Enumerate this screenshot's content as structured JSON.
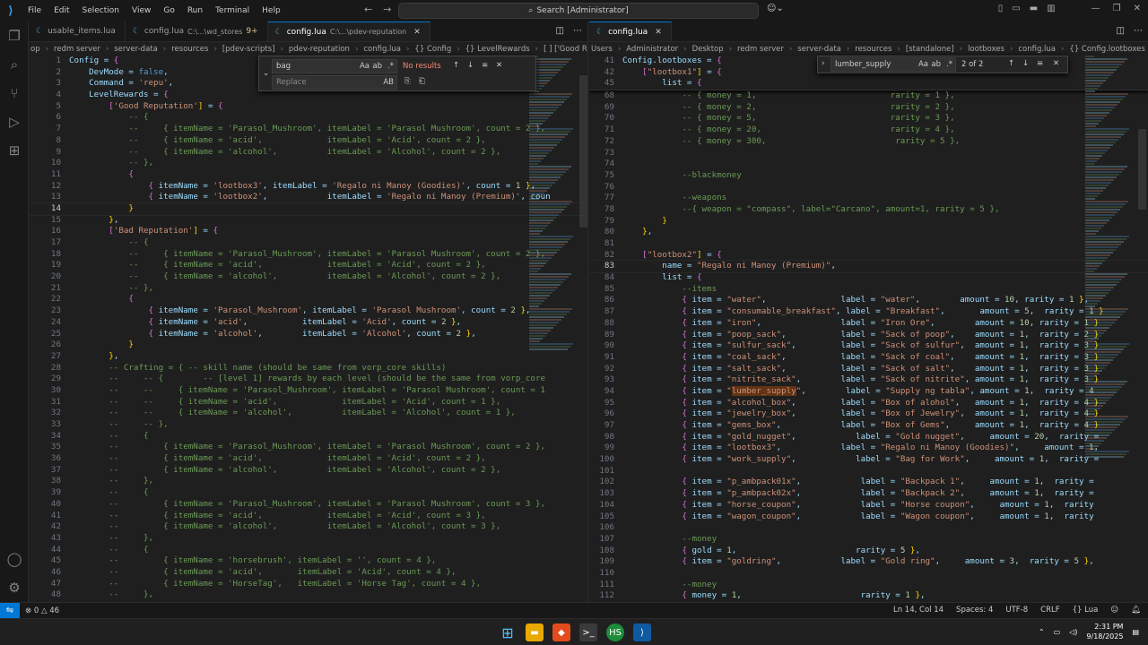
{
  "menu": [
    "File",
    "Edit",
    "Selection",
    "View",
    "Go",
    "Run",
    "Terminal",
    "Help"
  ],
  "command_center": "Search [Administrator]",
  "left": {
    "tabs": [
      {
        "label": "usable_items.lua",
        "desc": "",
        "mod": "",
        "active": false
      },
      {
        "label": "config.lua",
        "desc": "C:\\...\\wd_stores",
        "mod": "9+",
        "active": false
      },
      {
        "label": "config.lua",
        "desc": "C:\\...\\pdev-reputation",
        "mod": "",
        "active": true
      }
    ],
    "breadcrumb": [
      "op",
      "redm server",
      "server-data",
      "resources",
      "[pdev-scripts]",
      "pdev-reputation",
      "config.lua",
      "{} Config",
      "{} LevelRewards",
      "[ ] ['Good Reputation']",
      "[1]"
    ],
    "find": {
      "value": "bag",
      "result": "No results",
      "replace_placeholder": "Replace"
    },
    "cursor_line": 14,
    "lines": [
      {
        "n": 1,
        "t": "Config = {"
      },
      {
        "n": 2,
        "t": "    DevMode = false,"
      },
      {
        "n": 3,
        "t": "    Command = 'repu',"
      },
      {
        "n": 4,
        "t": "    LevelRewards = {"
      },
      {
        "n": 5,
        "t": "        ['Good Reputation'] = {"
      },
      {
        "n": 6,
        "t": "            -- {"
      },
      {
        "n": 7,
        "t": "            --     { itemName = 'Parasol_Mushroom', itemLabel = 'Parasol Mushroom', count = 2 },"
      },
      {
        "n": 8,
        "t": "            --     { itemName = 'acid',             itemLabel = 'Acid', count = 2 },"
      },
      {
        "n": 9,
        "t": "            --     { itemName = 'alcohol',          itemLabel = 'Alcohol', count = 2 },"
      },
      {
        "n": 10,
        "t": "            -- },"
      },
      {
        "n": 11,
        "t": "            {"
      },
      {
        "n": 12,
        "t": "                { itemName = 'lootbox3', itemLabel = 'Regalo ni Manoy (Goodies)', count = 1 },"
      },
      {
        "n": 13,
        "t": "                { itemName = 'lootbox2',            itemLabel = 'Regalo ni Manoy (Premium)', coun"
      },
      {
        "n": 14,
        "t": "            }"
      },
      {
        "n": 15,
        "t": "        },"
      },
      {
        "n": 16,
        "t": "        ['Bad Reputation'] = {"
      },
      {
        "n": 17,
        "t": "            -- {"
      },
      {
        "n": 18,
        "t": "            --     { itemName = 'Parasol_Mushroom', itemLabel = 'Parasol Mushroom', count = 2 },"
      },
      {
        "n": 19,
        "t": "            --     { itemName = 'acid',             itemLabel = 'Acid', count = 2 },"
      },
      {
        "n": 20,
        "t": "            --     { itemName = 'alcohol',          itemLabel = 'Alcohol', count = 2 },"
      },
      {
        "n": 21,
        "t": "            -- },"
      },
      {
        "n": 22,
        "t": "            {"
      },
      {
        "n": 23,
        "t": "                { itemName = 'Parasol_Mushroom', itemLabel = 'Parasol Mushroom', count = 2 },"
      },
      {
        "n": 24,
        "t": "                { itemName = 'acid',           itemLabel = 'Acid', count = 2 },"
      },
      {
        "n": 25,
        "t": "                { itemName = 'alcohol',        itemLabel = 'Alcohol', count = 2 },"
      },
      {
        "n": 26,
        "t": "            }"
      },
      {
        "n": 27,
        "t": "        },"
      },
      {
        "n": 28,
        "t": "        -- Crafting = { -- skill name (should be same from vorp_core skills)"
      },
      {
        "n": 29,
        "t": "        --     -- {        -- [level 1] rewards by each level (should be the same from vorp_core"
      },
      {
        "n": 30,
        "t": "        --     --     { itemName = 'Parasol_Mushroom', itemLabel = 'Parasol Mushroom', count = 1"
      },
      {
        "n": 31,
        "t": "        --     --     { itemName = 'acid',             itemLabel = 'Acid', count = 1 },"
      },
      {
        "n": 32,
        "t": "        --     --     { itemName = 'alcohol',          itemLabel = 'Alcohol', count = 1 },"
      },
      {
        "n": 33,
        "t": "        --     -- },"
      },
      {
        "n": 34,
        "t": "        --     {"
      },
      {
        "n": 35,
        "t": "        --         { itemName = 'Parasol_Mushroom', itemLabel = 'Parasol Mushroom', count = 2 },"
      },
      {
        "n": 36,
        "t": "        --         { itemName = 'acid',             itemLabel = 'Acid', count = 2 },"
      },
      {
        "n": 37,
        "t": "        --         { itemName = 'alcohol',          itemLabel = 'Alcohol', count = 2 },"
      },
      {
        "n": 38,
        "t": "        --     },"
      },
      {
        "n": 39,
        "t": "        --     {"
      },
      {
        "n": 40,
        "t": "        --         { itemName = 'Parasol_Mushroom', itemLabel = 'Parasol Mushroom', count = 3 },"
      },
      {
        "n": 41,
        "t": "        --         { itemName = 'acid',             itemLabel = 'Acid', count = 3 },"
      },
      {
        "n": 42,
        "t": "        --         { itemName = 'alcohol',          itemLabel = 'Alcohol', count = 3 },"
      },
      {
        "n": 43,
        "t": "        --     },"
      },
      {
        "n": 44,
        "t": "        --     {"
      },
      {
        "n": 45,
        "t": "        --         { itemName = 'horsebrush', itemLabel = '', count = 4 },"
      },
      {
        "n": 46,
        "t": "        --         { itemName = 'acid',       itemLabel = 'Acid', count = 4 },"
      },
      {
        "n": 47,
        "t": "        --         { itemName = 'HorseTag',   itemLabel = 'Horse Tag', count = 4 },"
      },
      {
        "n": 48,
        "t": "        --     },"
      }
    ]
  },
  "right": {
    "tabs": [
      {
        "label": "config.lua",
        "desc": "",
        "mod": "",
        "active": true
      }
    ],
    "breadcrumb": [
      "Users",
      "Administrator",
      "Desktop",
      "redm server",
      "server-data",
      "resources",
      "[standalone]",
      "lootboxes",
      "config.lua",
      "{} Config.lootboxes",
      "{} [\"lootbox2\"]"
    ],
    "find": {
      "value": "lumber_supply",
      "result": "2 of 2"
    },
    "sticky": [
      {
        "n": 41,
        "t": "Config.lootboxes = {"
      },
      {
        "n": 42,
        "t": "    [\"lootbox1\"] = {"
      },
      {
        "n": 45,
        "t": "        list = {"
      }
    ],
    "cursor_line": 83,
    "lines": [
      {
        "n": 68,
        "t": "            -- { money = 1,                           rarity = 1 },"
      },
      {
        "n": 69,
        "t": "            -- { money = 2,                           rarity = 2 },"
      },
      {
        "n": 70,
        "t": "            -- { money = 5,                           rarity = 3 },"
      },
      {
        "n": 71,
        "t": "            -- { money = 20,                          rarity = 4 },"
      },
      {
        "n": 72,
        "t": "            -- { money = 300,                          rarity = 5 },"
      },
      {
        "n": 73,
        "t": ""
      },
      {
        "n": 74,
        "t": ""
      },
      {
        "n": 75,
        "t": "            --blackmoney"
      },
      {
        "n": 76,
        "t": ""
      },
      {
        "n": 77,
        "t": "            --weapons"
      },
      {
        "n": 78,
        "t": "            --{ weapon = \"compass\", label=\"Carcano\", amount=1, rarity = 5 },"
      },
      {
        "n": 79,
        "t": "        }"
      },
      {
        "n": 80,
        "t": "    },"
      },
      {
        "n": 81,
        "t": ""
      },
      {
        "n": 82,
        "t": "    [\"lootbox2\"] = {"
      },
      {
        "n": 83,
        "t": "        name = \"Regalo ni Manoy (Premium)\","
      },
      {
        "n": 84,
        "t": "        list = {"
      },
      {
        "n": 85,
        "t": "            --items"
      },
      {
        "n": 86,
        "t": "            { item = \"water\",               label = \"water\",        amount = 10, rarity = 1 },"
      },
      {
        "n": 87,
        "t": "            { item = \"consumable_breakfast\", label = \"Breakfast\",       amount = 5,  rarity = 1 }"
      },
      {
        "n": 88,
        "t": "            { item = \"iron\",                label = \"Iron Ore\",        amount = 10, rarity = 1 }"
      },
      {
        "n": 89,
        "t": "            { item = \"poop_sack\",           label = \"Sack of poop\",    amount = 1,  rarity = 2 }"
      },
      {
        "n": 90,
        "t": "            { item = \"sulfur_sack\",         label = \"Sack of sulfur\",  amount = 1,  rarity = 3 }"
      },
      {
        "n": 91,
        "t": "            { item = \"coal_sack\",           label = \"Sack of coal\",    amount = 1,  rarity = 3 }"
      },
      {
        "n": 92,
        "t": "            { item = \"salt_sack\",           label = \"Sack of salt\",    amount = 1,  rarity = 3 }"
      },
      {
        "n": 93,
        "t": "            { item = \"nitrite_sack\",        label = \"Sack of nitrite\", amount = 1,  rarity = 3 }"
      },
      {
        "n": 94,
        "t": "            { item = \"lumber_supply\",        label = \"Supply ng tabla\", amount = 1,  rarity = 4"
      },
      {
        "n": 95,
        "t": "            { item = \"alcohol_box\",         label = \"Box of alohol\",   amount = 1,  rarity = 4 }"
      },
      {
        "n": 96,
        "t": "            { item = \"jewelry_box\",         label = \"Box of Jewelry\",  amount = 1,  rarity = 4 }"
      },
      {
        "n": 97,
        "t": "            { item = \"gems_box\",            label = \"Box of Gems\",     amount = 1,  rarity = 4 }"
      },
      {
        "n": 98,
        "t": "            { item = \"gold_nugget\",            label = \"Gold nugget\",     amount = 20,  rarity ="
      },
      {
        "n": 99,
        "t": "            { item = \"lootbox3\",            label = \"Regalo ni Manoy (Goodies)\",     amount = 1,"
      },
      {
        "n": 100,
        "t": "            { item = \"work_supply\",            label = \"Bag for Work\",     amount = 1,  rarity ="
      },
      {
        "n": 101,
        "t": ""
      },
      {
        "n": 102,
        "t": "            { item = \"p_ambpack01x\",            label = \"Backpack 1\",     amount = 1,  rarity ="
      },
      {
        "n": 103,
        "t": "            { item = \"p_ambpack02x\",            label = \"Backpack 2\",     amount = 1,  rarity ="
      },
      {
        "n": 104,
        "t": "            { item = \"horse_coupon\",            label = \"Horse coupon\",     amount = 1,  rarity"
      },
      {
        "n": 105,
        "t": "            { item = \"wagon_coupon\",            label = \"Wagon coupon\",     amount = 1,  rarity"
      },
      {
        "n": 106,
        "t": ""
      },
      {
        "n": 107,
        "t": "            --money"
      },
      {
        "n": 108,
        "t": "            { gold = 1,                        rarity = 5 },"
      },
      {
        "n": 109,
        "t": "            { item = \"goldring\",            label = \"Gold ring\",     amount = 3,  rarity = 5 },"
      },
      {
        "n": 110,
        "t": ""
      },
      {
        "n": 111,
        "t": "            --money"
      },
      {
        "n": 112,
        "t": "            { money = 1,                        rarity = 1 },"
      }
    ]
  },
  "status": {
    "errors": "0",
    "warnings": "46",
    "position": "Ln 14, Col 14",
    "spaces": "Spaces: 4",
    "encoding": "UTF-8",
    "eol": "CRLF",
    "language": "Lua"
  },
  "taskbar": {
    "time": "2:31 PM",
    "date": "9/18/2025"
  }
}
